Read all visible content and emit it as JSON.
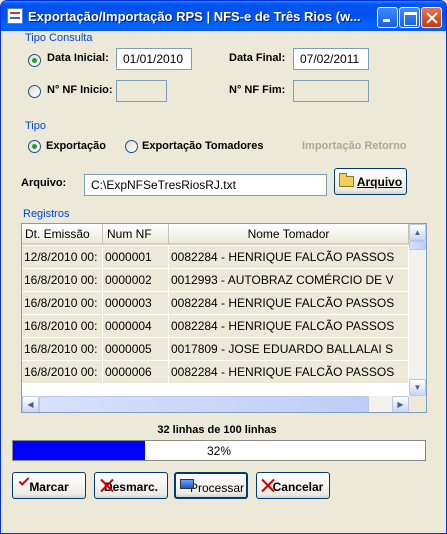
{
  "window": {
    "title": "Exportação/Importação RPS  |  NFS-e de Três Rios (w..."
  },
  "tipo_consulta": {
    "group_label": "Tipo Consulta",
    "data_inicial_label": "Data Inicial:",
    "data_inicial_value": "01/01/2010",
    "data_final_label": "Data Final:",
    "data_final_value": "07/02/2011",
    "nf_inicio_label": "N° NF Inicio:",
    "nf_inicio_value": "",
    "nf_fim_label": "N° NF Fim:",
    "nf_fim_value": ""
  },
  "tipo": {
    "group_label": "Tipo",
    "exportacao_label": "Exportação",
    "exportacao_tomadores_label": "Exportação Tomadores",
    "importacao_retorno_label": "Importação Retorno"
  },
  "arquivo": {
    "label": "Arquivo:",
    "value": "C:\\ExpNFSeTresRiosRJ.txt",
    "button_label": "Arquivo",
    "button_icon": "folder-icon"
  },
  "registros": {
    "group_label": "Registros",
    "columns": [
      "Dt. Emissão",
      "Num NF",
      "Nome Tomador"
    ],
    "rows": [
      [
        "12/8/2010 00:",
        "0000001",
        "0082284 - HENRIQUE FALCÃO PASSOS"
      ],
      [
        "16/8/2010 00:",
        "0000002",
        "0012993 - AUTOBRAZ COMÉRCIO DE V"
      ],
      [
        "16/8/2010 00:",
        "0000003",
        "0082284 - HENRIQUE FALCÃO PASSOS"
      ],
      [
        "16/8/2010 00:",
        "0000004",
        "0082284 - HENRIQUE FALCÃO PASSOS"
      ],
      [
        "16/8/2010 00:",
        "0000005",
        "0017809 - JOSE EDUARDO BALLALAI S"
      ],
      [
        "16/8/2010 00:",
        "0000006",
        "0082284 - HENRIQUE FALCÃO PASSOS"
      ]
    ]
  },
  "status": {
    "lines_text": "32 linhas de 100 linhas",
    "progress_percent": 32,
    "progress_text": "32%",
    "progress_color": "#0000FF"
  },
  "buttons": {
    "marcar": "Marcar",
    "desmarcar": "Desmarc.",
    "processar": "Processar",
    "cancelar": "Cancelar"
  }
}
